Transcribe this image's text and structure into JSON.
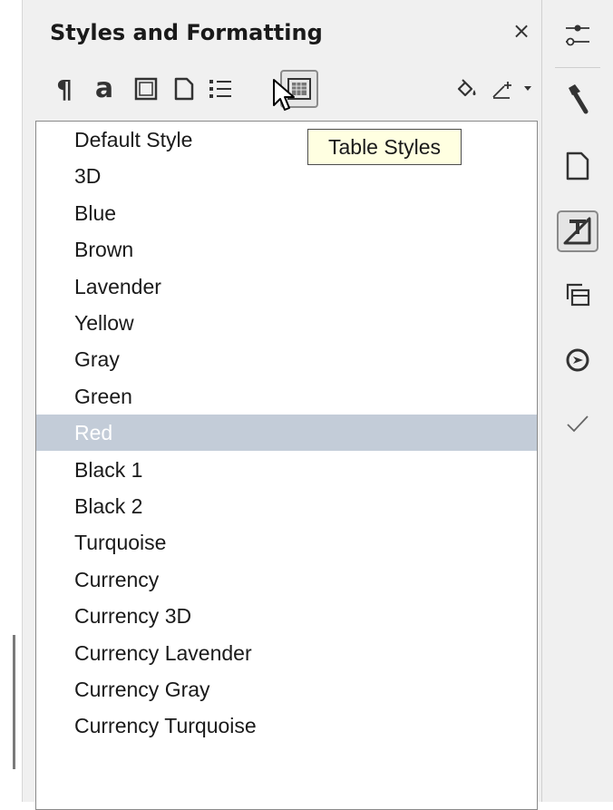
{
  "panel": {
    "title": "Styles and Formatting",
    "close_glyph": "×"
  },
  "toolbar": {
    "buttons": [
      {
        "name": "paragraph-styles-icon"
      },
      {
        "name": "character-styles-icon"
      },
      {
        "name": "frame-styles-icon"
      },
      {
        "name": "page-styles-icon"
      },
      {
        "name": "list-styles-icon"
      },
      {
        "name": "table-styles-icon",
        "active": true
      },
      {
        "name": "fill-format-mode-icon"
      },
      {
        "name": "new-style-from-selection-icon"
      },
      {
        "name": "dropdown-arrow-icon"
      }
    ],
    "paragraph_glyph": "¶",
    "character_glyph": "a"
  },
  "tooltip": {
    "text": "Table Styles"
  },
  "styles": {
    "items": [
      "Default Style",
      "3D",
      "Blue",
      "Brown",
      "Lavender",
      "Yellow",
      "Gray",
      "Green",
      "Red",
      "Black 1",
      "Black 2",
      "Turquoise",
      "Currency",
      "Currency 3D",
      "Currency Lavender",
      "Currency Gray",
      "Currency Turquoise"
    ],
    "selected_index": 8
  },
  "sidebar": {
    "buttons": [
      {
        "name": "properties-icon"
      },
      {
        "name": "styles-icon"
      },
      {
        "name": "page-icon"
      },
      {
        "name": "style-inspector-icon",
        "active": true
      },
      {
        "name": "gallery-icon"
      },
      {
        "name": "navigator-icon"
      },
      {
        "name": "manage-changes-icon"
      }
    ]
  },
  "colors": {
    "selection_bg": "#c3ccd8",
    "tooltip_bg": "#ffffe1",
    "panel_bg": "#f0f0f0"
  }
}
